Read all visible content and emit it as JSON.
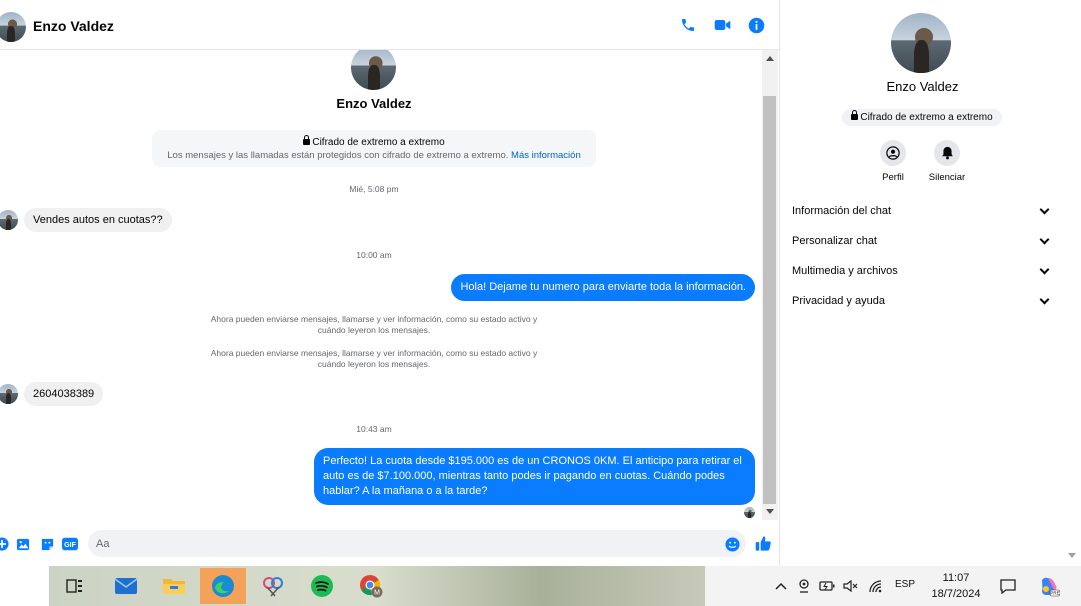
{
  "contact": {
    "name": "Enzo Valdez"
  },
  "intro": {
    "name": "Enzo Valdez",
    "e2e_title": "Cifrado de extremo a extremo",
    "e2e_text": "Los mensajes y las llamadas están protegidos con cifrado de extremo a extremo.",
    "e2e_link": "Más información"
  },
  "messages": {
    "ts1": "Mié, 5:08 pm",
    "m1": "Vendes autos en cuotas??",
    "ts2": "10:00 am",
    "m2": "Hola! Dejame tu numero  para enviarte toda la información.",
    "sys1": "Ahora pueden enviarse mensajes, llamarse y ver información, como su estado activo y cuándo leyeron los mensajes.",
    "sys2": "Ahora pueden enviarse mensajes, llamarse y ver información, como su estado activo y cuándo leyeron los mensajes.",
    "m3": "2604038389",
    "ts3": "10:43 am",
    "m4": "Perfecto! La cuota desde $195.000 es de un CRONOS 0KM. El anticipo para retirar el auto es de $7.100.000, mientras tanto podes ir pagando en cuotas. Cuándo podes hablar? A la mañana o a la tarde?"
  },
  "composer": {
    "placeholder": "Aa"
  },
  "panel": {
    "name": "Enzo Valdez",
    "e2e": "Cifrado de extremo a extremo",
    "profile_label": "Perfil",
    "mute_label": "Silenciar",
    "menu": [
      "Información del chat",
      "Personalizar chat",
      "Multimedia y archivos",
      "Privacidad y ayuda"
    ]
  },
  "taskbar": {
    "lang": "ESP",
    "time": "11:07",
    "date": "18/7/2024"
  },
  "colors": {
    "accent": "#0a7cff",
    "link": "#0064d1",
    "bubble_in": "#f0f0f0"
  }
}
